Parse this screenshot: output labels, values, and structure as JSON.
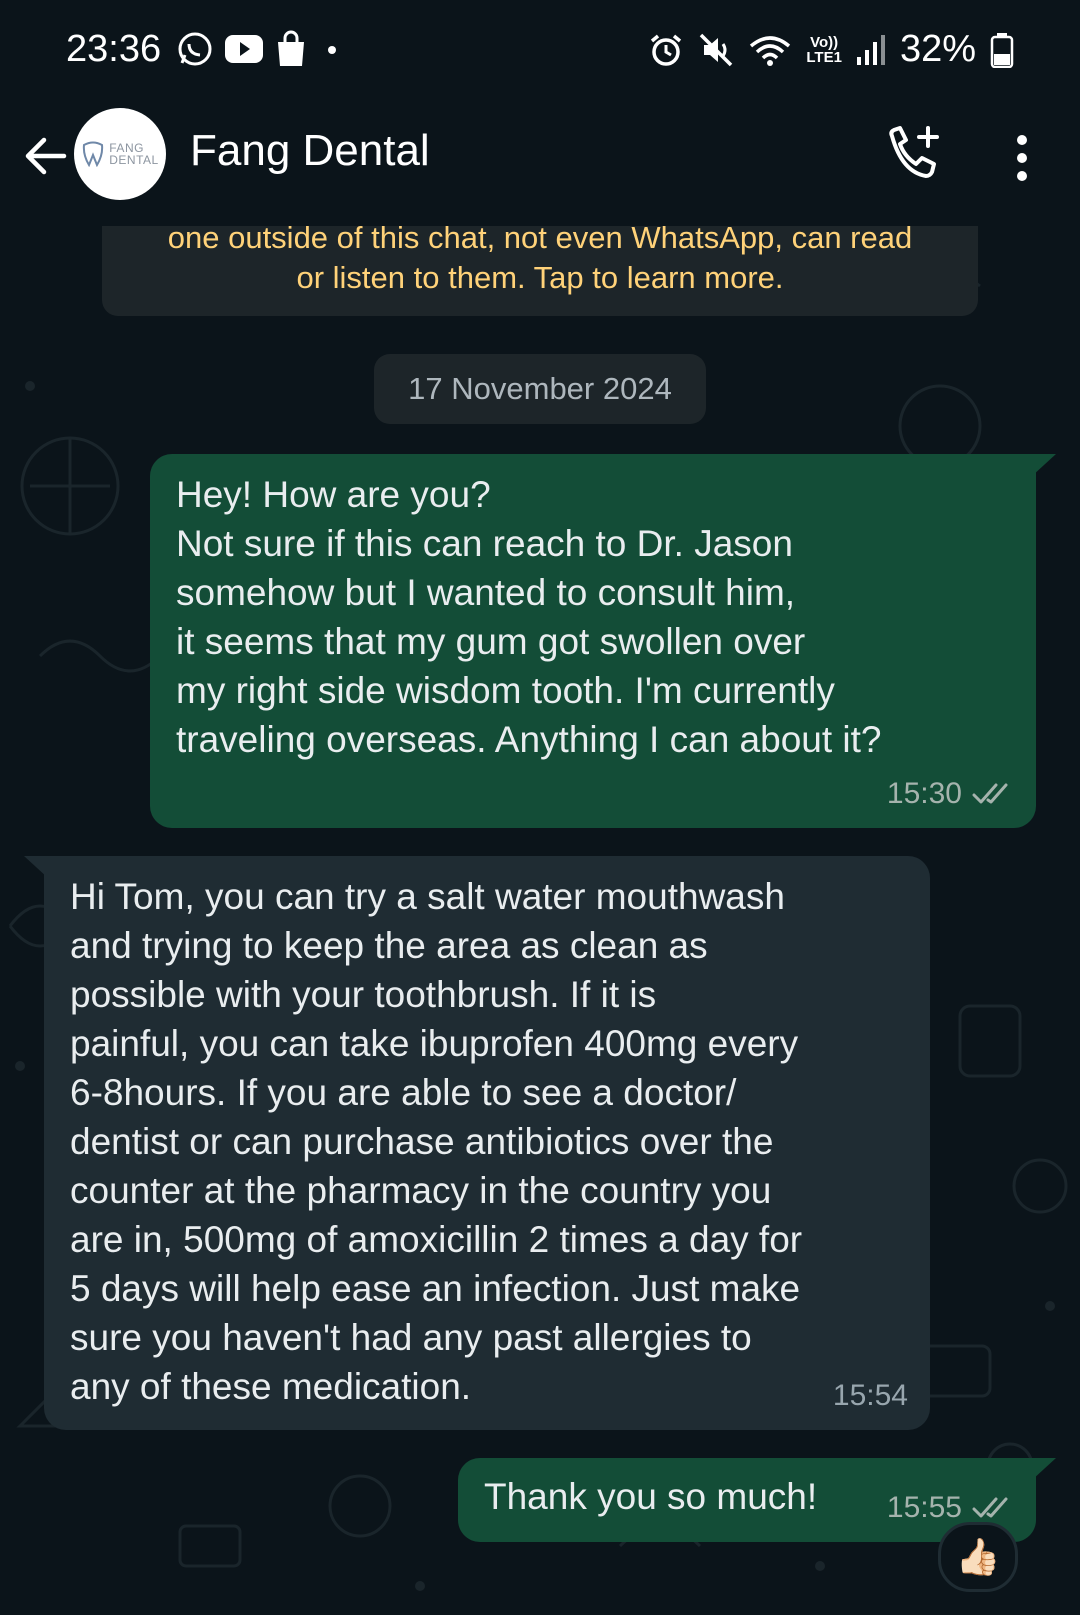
{
  "status_bar": {
    "time": "23:36",
    "battery": "32%",
    "left_icons": [
      "whatsapp-icon",
      "youtube-icon",
      "shopping-bag-icon",
      "dot-icon"
    ],
    "right_icons": [
      "alarm-icon",
      "mute-icon",
      "wifi-icon",
      "volte-icon",
      "signal-icon",
      "battery-icon"
    ],
    "network_label": "Vo))\nLTE1",
    "wifi_label": "6"
  },
  "header": {
    "contact_name": "Fang Dental",
    "avatar_text_1": "FANG",
    "avatar_text_2": "DENTAL"
  },
  "chat": {
    "encryption_notice": "one outside of this chat, not even WhatsApp, can read\nor listen to them. Tap to learn more.",
    "date_chip": "17 November 2024",
    "messages": [
      {
        "direction": "outgoing",
        "text": "Hey! How are you?\nNot sure if this can reach to Dr. Jason\nsomehow but I wanted to consult him,\nit seems that my gum got swollen over\nmy right side wisdom tooth. I'm currently\ntraveling overseas. Anything I can about it?",
        "time": "15:30",
        "status": "read-double-tick"
      },
      {
        "direction": "incoming",
        "text": "Hi Tom, you can try a salt water mouthwash\nand trying to keep the area as clean as\npossible with your toothbrush. If it is\npainful, you can take ibuprofen 400mg every\n6-8hours. If you are able to see a doctor/\ndentist or can purchase antibiotics over the\ncounter at the pharmacy in the country you\nare in, 500mg of amoxicillin 2 times a day for\n5 days will help ease an infection. Just make\nsure you haven't had any past allergies to\nany of these medication.",
        "time": "15:54"
      },
      {
        "direction": "outgoing",
        "text": "Thank you so much!",
        "time": "15:55",
        "status": "read-double-tick",
        "reaction": "👍🏻"
      }
    ]
  },
  "colors": {
    "background": "#0b141a",
    "outgoing_bubble": "#134d37",
    "incoming_bubble": "#1f2c33",
    "notice_text": "#ffd279",
    "read_tick": "#a5b3ad"
  }
}
